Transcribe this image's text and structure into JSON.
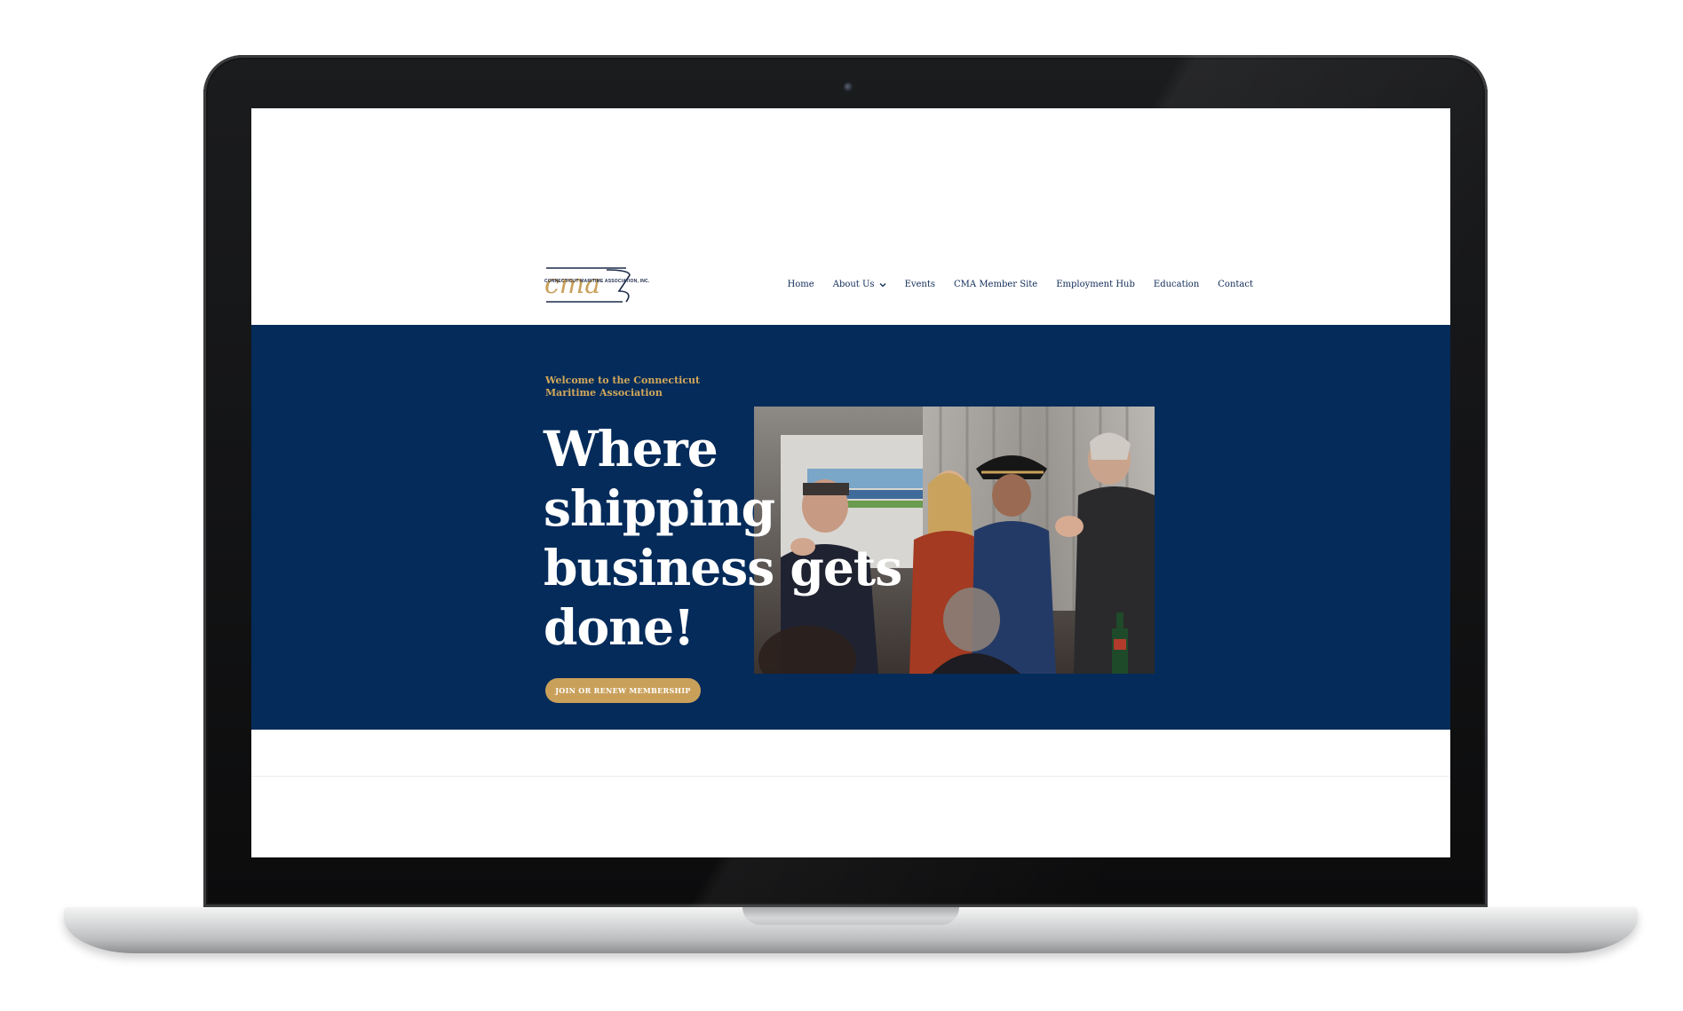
{
  "site": {
    "logo_text": "CONNECTICUT MARITIME ASSOCIATION, INC.",
    "logo_mark": "cma"
  },
  "nav": {
    "items": [
      "Home",
      "About Us",
      "Events",
      "CMA Member Site",
      "Employment Hub",
      "Education",
      "Contact"
    ]
  },
  "hero": {
    "eyebrow": "Welcome to the Connecticut Maritime Association",
    "heading": "Where shipping business gets done!",
    "cta_label": "JOIN OR RENEW MEMBERSHIP"
  },
  "colors": {
    "navy": "#042b5a",
    "gold": "#c9a05a",
    "nav_text": "#0f2a57"
  }
}
